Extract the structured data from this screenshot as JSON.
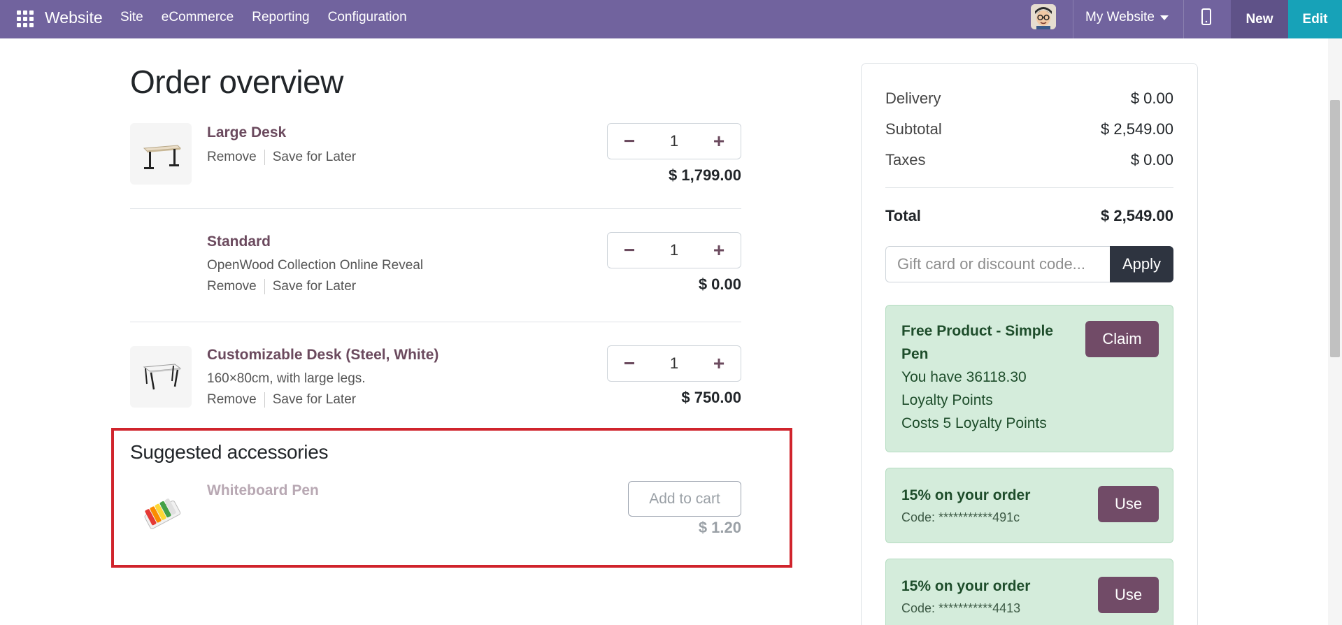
{
  "navbar": {
    "brand": "Website",
    "menu": [
      "Site",
      "eCommerce",
      "Reporting",
      "Configuration"
    ],
    "website_selector": "My Website",
    "new_label": "New",
    "edit_label": "Edit",
    "bg_color": "#71639e",
    "edit_color": "#17a2b8"
  },
  "page": {
    "title": "Order overview"
  },
  "cart": {
    "lines": [
      {
        "name": "Large Desk",
        "description": "",
        "remove": "Remove",
        "save_later": "Save for Later",
        "qty": "1",
        "price": "$ 1,799.00"
      },
      {
        "name": "Standard",
        "description": "OpenWood Collection Online Reveal",
        "remove": "Remove",
        "save_later": "Save for Later",
        "qty": "1",
        "price": "$ 0.00"
      },
      {
        "name": "Customizable Desk (Steel, White)",
        "description": "160×80cm, with large legs.",
        "remove": "Remove",
        "save_later": "Save for Later",
        "qty": "1",
        "price": "$ 750.00"
      }
    ]
  },
  "suggested": {
    "title": "Suggested accessories",
    "item_name": "Whiteboard Pen",
    "add_label": "Add to cart",
    "price": "$ 1.20"
  },
  "summary": {
    "delivery_label": "Delivery",
    "delivery_value": "$ 0.00",
    "subtotal_label": "Subtotal",
    "subtotal_value": "$ 2,549.00",
    "taxes_label": "Taxes",
    "taxes_value": "$ 0.00",
    "total_label": "Total",
    "total_value": "$ 2,549.00",
    "promo_placeholder": "Gift card or discount code...",
    "apply_label": "Apply"
  },
  "rewards": [
    {
      "title_line1": "Free Product - Simple",
      "title_line2": "Pen",
      "line1": "You have 36118.30",
      "line2": "Loyalty Points",
      "line3": "Costs 5 Loyalty Points",
      "button": "Claim"
    },
    {
      "title": "15% on your order",
      "code": "Code: ***********491c",
      "button": "Use"
    },
    {
      "title": "15% on your order",
      "code": "Code: ***********4413",
      "button": "Use"
    }
  ]
}
